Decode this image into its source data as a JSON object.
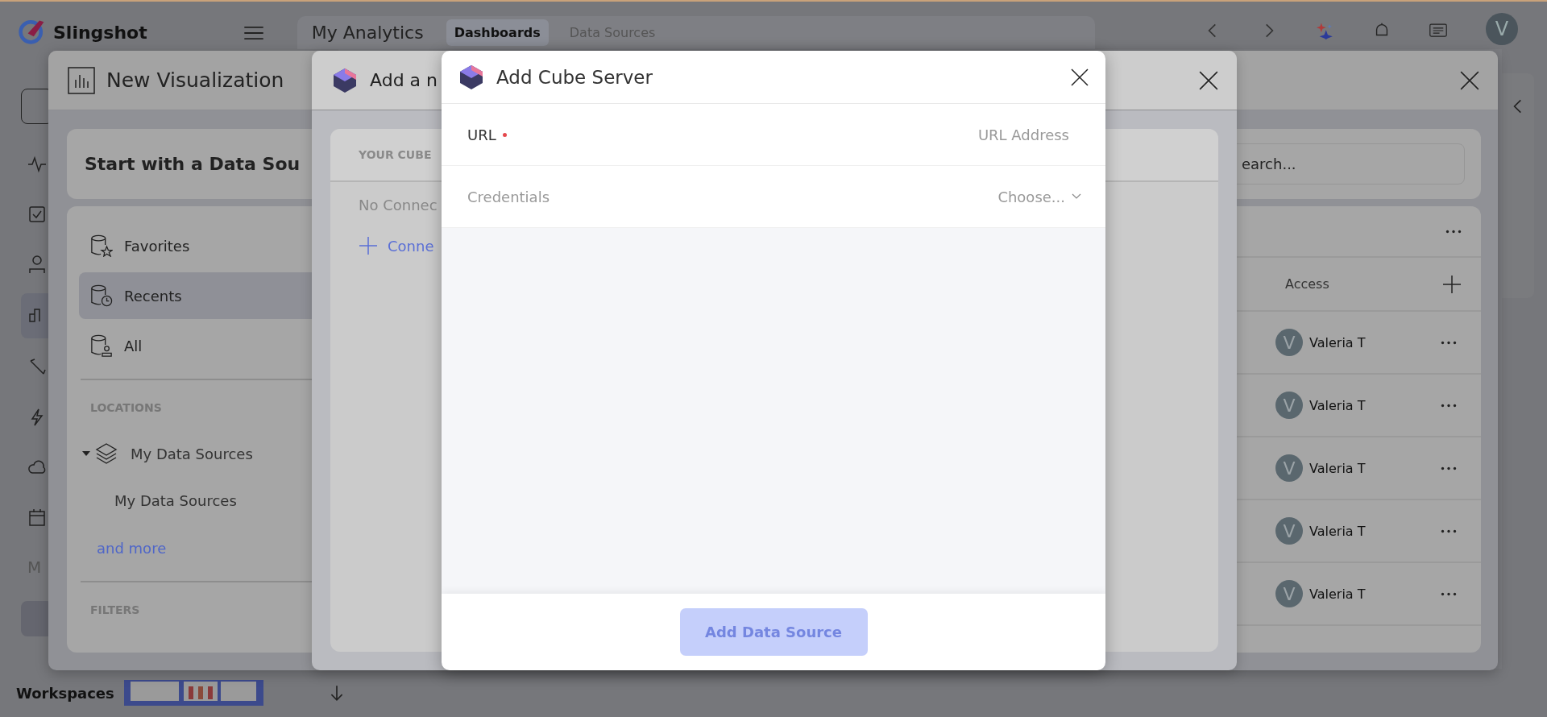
{
  "app": {
    "logo": "Slingshot",
    "header_title": "My Analytics",
    "tabs": [
      {
        "label": "Dashboards",
        "selected": true
      },
      {
        "label": "Data Sources",
        "selected": false
      }
    ],
    "user_initial": "V",
    "rail_label": "M",
    "workspaces": "Workspaces"
  },
  "new_visualization": {
    "title": "New Visualization",
    "heading": "Start with a Data Sou",
    "nav": [
      {
        "label": "Favorites",
        "kind": "favorites",
        "selected": false
      },
      {
        "label": "Recents",
        "kind": "recents",
        "selected": true
      },
      {
        "label": "All",
        "kind": "all",
        "selected": false
      }
    ],
    "locations_heading": "LOCATIONS",
    "locations": [
      {
        "label": "My Data Sources",
        "expanded": true,
        "children": [
          {
            "label": "My Data Sources"
          }
        ]
      }
    ],
    "more_link": "and more",
    "filters_heading": "FILTERS",
    "search": {
      "placeholder": "earch..."
    },
    "table": {
      "columns": [
        "Access"
      ],
      "rows": [
        {
          "initial": "V",
          "owner": "Valeria T"
        },
        {
          "initial": "V",
          "owner": "Valeria T"
        },
        {
          "initial": "V",
          "owner": "Valeria T"
        },
        {
          "initial": "V",
          "owner": "Valeria T"
        },
        {
          "initial": "V",
          "owner": "Valeria T"
        }
      ]
    }
  },
  "add_dialog": {
    "title": "Add a n",
    "section": "YOUR CUBE",
    "empty": "No Connec",
    "connect": "Conne"
  },
  "cube_server": {
    "title": "Add Cube Server",
    "fields": [
      {
        "kind": "text",
        "label": "URL",
        "required": true,
        "placeholder": "URL Address"
      },
      {
        "kind": "select",
        "label": "Credentials",
        "required": false,
        "placeholder": "Choose..."
      }
    ],
    "submit": {
      "label": "Add Data Source",
      "disabled": true
    }
  }
}
